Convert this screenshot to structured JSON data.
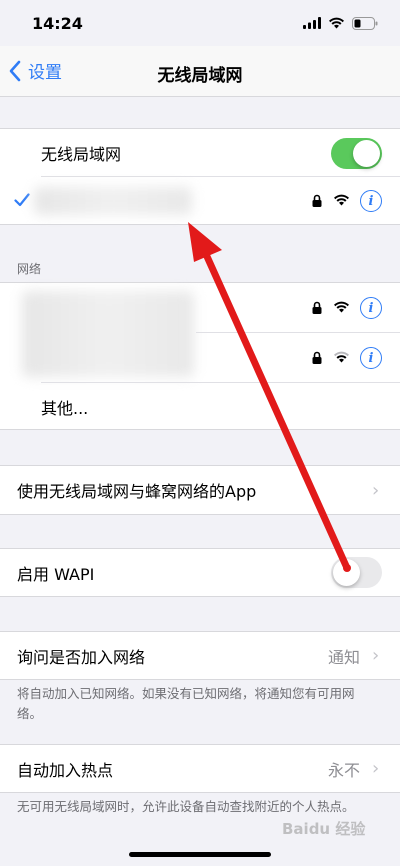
{
  "status": {
    "time": "14:24"
  },
  "nav": {
    "back_label": "设置",
    "title": "无线局域网"
  },
  "wifi": {
    "toggle_label": "无线局域网",
    "toggle_on": true,
    "connected_network_name": ""
  },
  "networks": {
    "header": "网络",
    "items": [
      {
        "name": "",
        "secured": true,
        "signal": "full"
      },
      {
        "name": "",
        "secured": true,
        "signal": "partial"
      }
    ],
    "other_label": "其他..."
  },
  "apps_using": {
    "label": "使用无线局域网与蜂窝网络的App"
  },
  "wapi": {
    "label": "启用 WAPI",
    "toggle_on": false
  },
  "ask_to_join": {
    "label": "询问是否加入网络",
    "value": "通知",
    "footer": "将自动加入已知网络。如果没有已知网络，将通知您有可用网络。"
  },
  "auto_join_hotspot": {
    "label": "自动加入热点",
    "value": "永不",
    "footer": "无可用无线局域网时，允许此设备自动查找附近的个人热点。"
  },
  "watermark": {
    "text": "Baidu 经验"
  },
  "colors": {
    "accent": "#2f7cf6",
    "toggle_on": "#5ac95c",
    "toggle_off": "#e9e9eb",
    "arrow": "#e21a1a"
  }
}
